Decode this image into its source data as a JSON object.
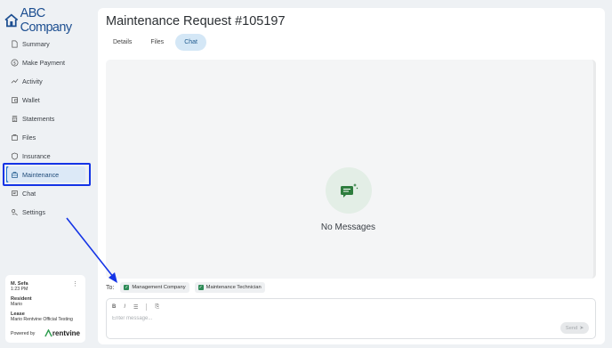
{
  "brand": {
    "name": "ABC Company",
    "color": "#1d4f91"
  },
  "sidebar": {
    "items": [
      {
        "label": "Summary",
        "icon": "document-icon"
      },
      {
        "label": "Make Payment",
        "icon": "dollar-circle-icon"
      },
      {
        "label": "Activity",
        "icon": "activity-line-icon"
      },
      {
        "label": "Wallet",
        "icon": "wallet-icon"
      },
      {
        "label": "Statements",
        "icon": "statements-icon"
      },
      {
        "label": "Files",
        "icon": "folder-icon"
      },
      {
        "label": "Insurance",
        "icon": "shield-icon"
      },
      {
        "label": "Maintenance",
        "icon": "toolbox-icon",
        "active": true
      },
      {
        "label": "Chat",
        "icon": "chat-icon"
      },
      {
        "label": "Settings",
        "icon": "settings-icon"
      }
    ]
  },
  "user_card": {
    "name": "M. Sefa",
    "time": "1:23 PM",
    "resident_label": "Resident",
    "resident_value": "Mario",
    "lease_label": "Lease",
    "lease_value": "Mario Rentvine Official Testing",
    "powered_by": "Powered by",
    "powered_brand": "rentvine"
  },
  "main": {
    "title": "Maintenance Request #105197",
    "tabs": [
      {
        "label": "Details"
      },
      {
        "label": "Files"
      },
      {
        "label": "Chat",
        "active": true
      }
    ],
    "empty_state": "No Messages",
    "to_label": "To:",
    "recipients": [
      {
        "label": "Management Company",
        "checked": true
      },
      {
        "label": "Maintenance Technician",
        "checked": true
      }
    ],
    "composer": {
      "bold": "B",
      "italic": "I",
      "placeholder": "Enter message...",
      "send_label": "Send"
    }
  },
  "colors": {
    "accent": "#1c6fd1",
    "highlight_box": "#1434e6",
    "check_green": "#2e8b57",
    "chat_icon_green": "#2e7d3e"
  }
}
